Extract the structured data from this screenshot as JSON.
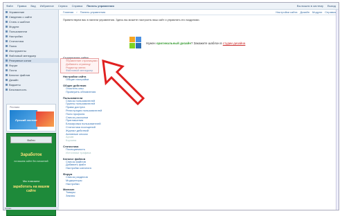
{
  "topbar": {
    "menu": [
      "Файл",
      "Правка",
      "Вид",
      "Избранное",
      "Сервис",
      "Справка",
      "Панель управления"
    ],
    "right": [
      "Вы вошли в систему",
      "Выход"
    ]
  },
  "sidebar": {
    "items": [
      {
        "label": "Управление",
        "selected": false
      },
      {
        "label": "Сведения о сайте",
        "selected": false
      },
      {
        "label": "Стиль и шаблон",
        "selected": false
      },
      {
        "label": "Модули",
        "selected": false
      },
      {
        "label": "Пользователи",
        "selected": false
      },
      {
        "label": "Настройки",
        "selected": false
      },
      {
        "label": "Статистика",
        "selected": false
      },
      {
        "label": "Поиск",
        "selected": false
      },
      {
        "label": "Инструменты",
        "selected": false
      },
      {
        "label": "Файловый менеджер",
        "selected": false
      },
      {
        "label": "Резервные копии",
        "selected": true
      },
      {
        "label": "Форум",
        "selected": false
      },
      {
        "label": "Почта",
        "selected": false
      },
      {
        "label": "Каталог файлов",
        "selected": false
      },
      {
        "label": "Дизайн",
        "selected": false
      },
      {
        "label": "Виджеты",
        "selected": false
      },
      {
        "label": "Безопасность",
        "selected": false
      }
    ]
  },
  "ad1": {
    "tag": "Реклама",
    "text": "Лучший хостинг"
  },
  "ad2": {
    "button": "Войти",
    "big": "Заработок",
    "sub": "на вашем сайте без вложений",
    "mid": "Мы поможем",
    "bold": "заработать на вашем сайте"
  },
  "crumb": {
    "left": [
      "Главная",
      "Панель управления"
    ],
    "right": [
      "Настройки сайта",
      "Дизайн",
      "Модули",
      "Справка"
    ]
  },
  "welcome": "Приветствуем вас в панели управления. Здесь вы можете настроить ваш сайт и управлять его модулями.",
  "banner": {
    "pre": "Нужен ",
    "green": "оригинальный дизайн",
    "mid": "? Закажите шаблон в ",
    "red": "студии дизайна"
  },
  "sections": [
    {
      "title": "Содержание сайта",
      "links": [
        {
          "t": "Управление страницами",
          "s": "red"
        },
        {
          "t": "Добавить страницу",
          "s": "red"
        },
        {
          "t": "Редактор меню",
          "s": "red"
        },
        {
          "t": "Файловый менеджер",
          "s": ""
        }
      ]
    },
    {
      "title": "Настройки сайта",
      "links": [
        {
          "t": "Общие настройки",
          "s": ""
        }
      ]
    },
    {
      "title": "Общие действия",
      "links": [
        {
          "t": "Очистить кэш",
          "s": ""
        },
        {
          "t": "Проверить обновления",
          "s": ""
        }
      ]
    },
    {
      "title": "Пользователи",
      "links": [
        {
          "t": "Список пользователей",
          "s": ""
        },
        {
          "t": "Группы пользователей",
          "s": ""
        },
        {
          "t": "Права доступа",
          "s": ""
        },
        {
          "t": "Регистрация пользователей",
          "s": ""
        },
        {
          "t": "Поля профиля",
          "s": ""
        },
        {
          "t": "Список рассылки",
          "s": ""
        },
        {
          "t": "Приглашения",
          "s": ""
        },
        {
          "t": "Блокировка пользователей",
          "s": ""
        },
        {
          "t": "Статистика посещений",
          "s": ""
        },
        {
          "t": "Журнал действий",
          "s": ""
        },
        {
          "t": "Активные сессии",
          "s": ""
        },
        {
          "t": "Архив",
          "s": "dim"
        },
        {
          "t": "Корзина",
          "s": "dim"
        }
      ]
    },
    {
      "title": "Статистика",
      "links": [
        {
          "t": "Посещаемость",
          "s": ""
        },
        {
          "t": "Источники трафика",
          "s": "dim"
        }
      ]
    },
    {
      "title": "Каталог файлов",
      "links": [
        {
          "t": "Список файлов",
          "s": ""
        },
        {
          "t": "Добавить файл",
          "s": ""
        },
        {
          "t": "Настройки каталога",
          "s": ""
        }
      ]
    },
    {
      "title": "Форум",
      "links": [
        {
          "t": "Список разделов",
          "s": ""
        },
        {
          "t": "Модераторы",
          "s": ""
        },
        {
          "t": "Настройки",
          "s": ""
        }
      ]
    },
    {
      "title": "Магазин",
      "links": [
        {
          "t": "Товары",
          "s": ""
        },
        {
          "t": "Заказы",
          "s": ""
        }
      ]
    }
  ],
  "status": "Готово",
  "colors": {
    "accent": "#2f6fb3",
    "arrow": "#e02020",
    "sidebar": "#e8eef5"
  }
}
